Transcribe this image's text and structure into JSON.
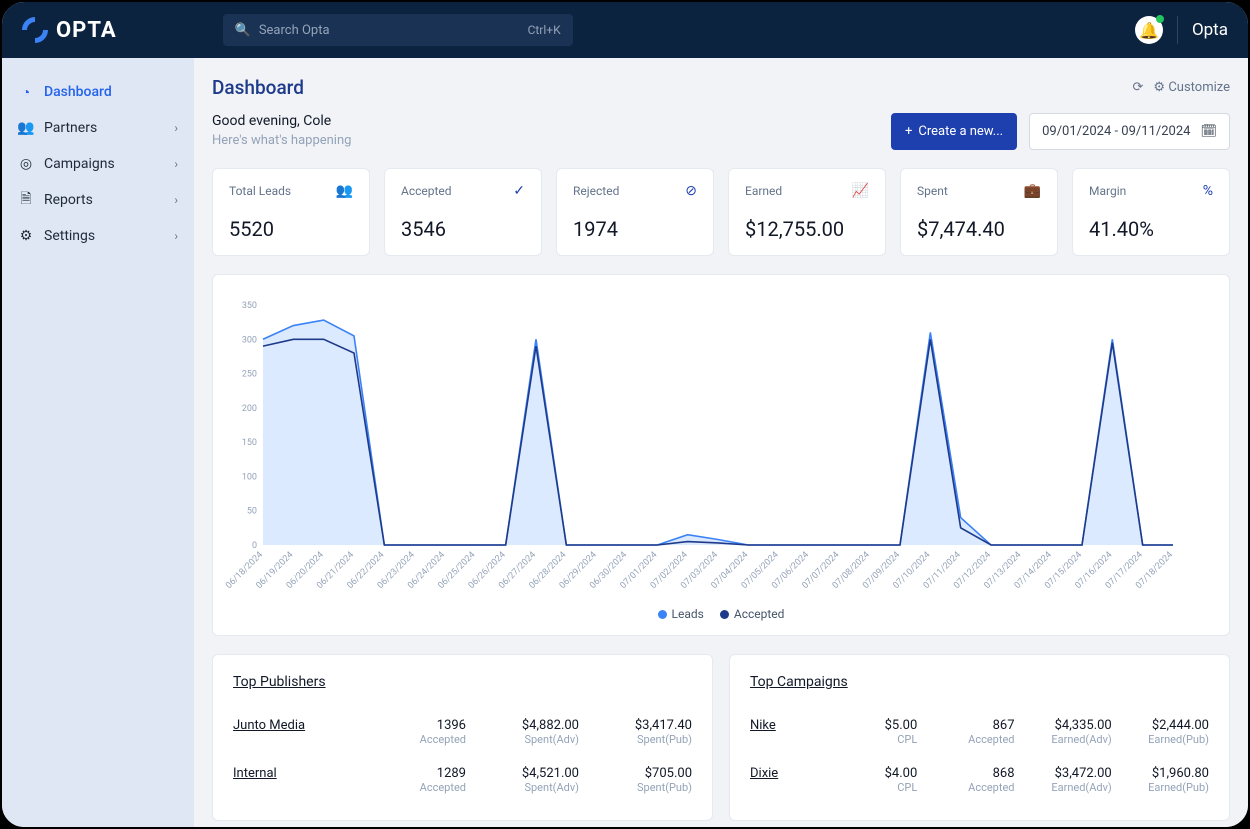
{
  "brand": "OPTA",
  "search": {
    "placeholder": "Search Opta",
    "shortcut": "Ctrl+K"
  },
  "user": {
    "name": "Opta"
  },
  "sidebar": [
    {
      "icon": "◔",
      "label": "Dashboard",
      "active": true,
      "chev": false
    },
    {
      "icon": "👥",
      "label": "Partners",
      "active": false,
      "chev": true
    },
    {
      "icon": "◎",
      "label": "Campaigns",
      "active": false,
      "chev": true
    },
    {
      "icon": "🗎",
      "label": "Reports",
      "active": false,
      "chev": true
    },
    {
      "icon": "⚙",
      "label": "Settings",
      "active": false,
      "chev": true
    }
  ],
  "page": {
    "title": "Dashboard",
    "customize": "Customize",
    "greeting": "Good evening, Cole",
    "subtitle": "Here's what's happening",
    "create": "Create a new...",
    "range": "09/01/2024 - 09/11/2024"
  },
  "cards": [
    {
      "label": "Total Leads",
      "value": "5520",
      "icon": "👥"
    },
    {
      "label": "Accepted",
      "value": "3546",
      "icon": "✓"
    },
    {
      "label": "Rejected",
      "value": "1974",
      "icon": "⊘"
    },
    {
      "label": "Earned",
      "value": "$12,755.00",
      "icon": "📈"
    },
    {
      "label": "Spent",
      "value": "$7,474.40",
      "icon": "💼"
    },
    {
      "label": "Margin",
      "value": "41.40%",
      "icon": "%"
    }
  ],
  "chart_data": {
    "type": "line",
    "title": "",
    "xlabel": "",
    "ylabel": "",
    "ylim": [
      0,
      350
    ],
    "yticks": [
      0,
      50,
      100,
      150,
      200,
      250,
      300,
      350
    ],
    "categories": [
      "06/18/2024",
      "06/19/2024",
      "06/20/2024",
      "06/21/2024",
      "06/22/2024",
      "06/23/2024",
      "06/24/2024",
      "06/25/2024",
      "06/26/2024",
      "06/27/2024",
      "06/28/2024",
      "06/29/2024",
      "06/30/2024",
      "07/01/2024",
      "07/02/2024",
      "07/03/2024",
      "07/04/2024",
      "07/05/2024",
      "07/06/2024",
      "07/07/2024",
      "07/08/2024",
      "07/09/2024",
      "07/10/2024",
      "07/11/2024",
      "07/12/2024",
      "07/13/2024",
      "07/14/2024",
      "07/15/2024",
      "07/16/2024",
      "07/17/2024",
      "07/18/2024"
    ],
    "series": [
      {
        "name": "Leads",
        "color": "#3b82f6",
        "values": [
          300,
          320,
          328,
          305,
          0,
          0,
          0,
          0,
          0,
          300,
          0,
          0,
          0,
          0,
          15,
          8,
          0,
          0,
          0,
          0,
          0,
          0,
          310,
          40,
          0,
          0,
          0,
          0,
          300,
          0,
          0
        ]
      },
      {
        "name": "Accepted",
        "color": "#1e3a8a",
        "values": [
          290,
          300,
          300,
          280,
          0,
          0,
          0,
          0,
          0,
          290,
          0,
          0,
          0,
          0,
          5,
          3,
          0,
          0,
          0,
          0,
          0,
          0,
          300,
          25,
          0,
          0,
          0,
          0,
          295,
          0,
          0
        ]
      }
    ],
    "legend": [
      "Leads",
      "Accepted"
    ]
  },
  "publishers": {
    "title": "Top Publishers",
    "cols": [
      "Accepted",
      "Spent(Adv)",
      "Spent(Pub)"
    ],
    "rows": [
      {
        "name": "Junto Media",
        "c1": "1396",
        "c2": "$4,882.00",
        "c3": "$3,417.40"
      },
      {
        "name": "Internal",
        "c1": "1289",
        "c2": "$4,521.00",
        "c3": "$705.00"
      }
    ]
  },
  "campaigns": {
    "title": "Top Campaigns",
    "cols": [
      "CPL",
      "Accepted",
      "Earned(Adv)",
      "Earned(Pub)"
    ],
    "rows": [
      {
        "name": "Nike",
        "c1": "$5.00",
        "c2": "867",
        "c3": "$4,335.00",
        "c4": "$2,444.00"
      },
      {
        "name": "Dixie",
        "c1": "$4.00",
        "c2": "868",
        "c3": "$3,472.00",
        "c4": "$1,960.80"
      }
    ]
  }
}
